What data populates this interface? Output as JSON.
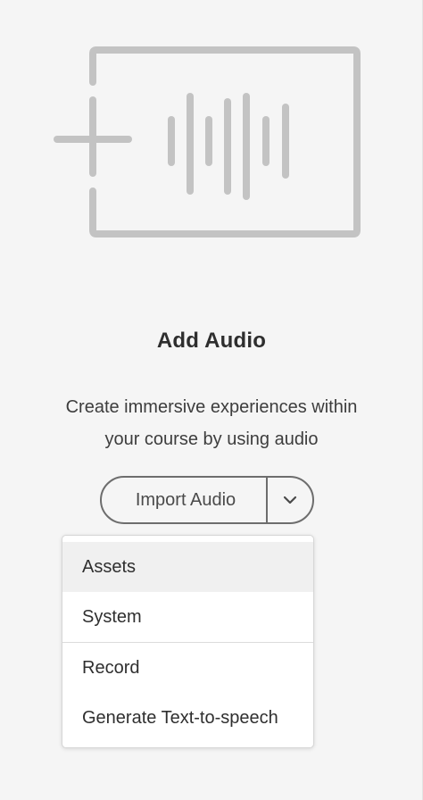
{
  "empty_state": {
    "illustration_icon": "add-audio-icon",
    "title": "Add Audio",
    "description_line1": "Create immersive experiences within",
    "description_line2": "your course by using audio"
  },
  "import_button": {
    "label": "Import Audio",
    "toggle_icon": "chevron-down-icon"
  },
  "dropdown_menu": {
    "items": [
      {
        "label": "Assets"
      },
      {
        "label": "System"
      },
      {
        "label": "Record"
      },
      {
        "label": "Generate Text-to-speech"
      }
    ]
  },
  "colors": {
    "background": "#f5f5f5",
    "illustration": "#c3c3c3",
    "button_border": "#6d6d6d",
    "menu_background": "#ffffff",
    "menu_hover": "#f0f0f0"
  }
}
